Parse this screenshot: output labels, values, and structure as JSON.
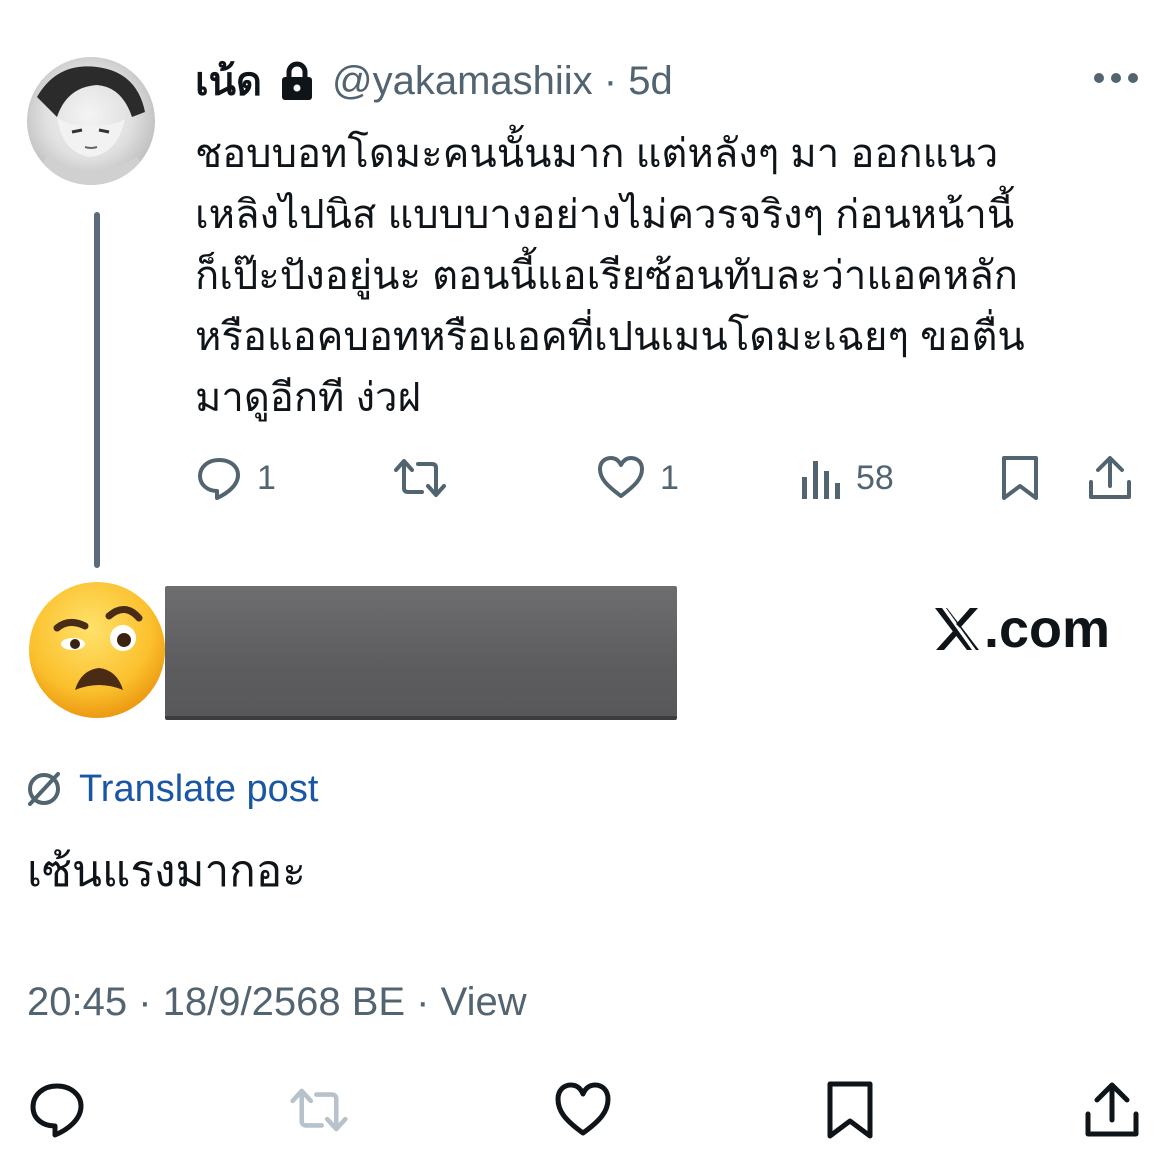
{
  "parent_tweet": {
    "display_name": "เน้ด",
    "handle_time": "@yakamashiix · 5d",
    "body_lines": [
      "ชอบบอทโดมะคนนั้นมาก แต่หลังๆ มา ออกแนว",
      "เหลิงไปนิส แบบบางอย่างไม่ควรจริงๆ ก่อนหน้านี้",
      "ก็เป๊ะปังอยู่นะ ตอนนี้แอเรียซ้อนทับละว่าแอคหลัก",
      "หรือแอคบอทหรือแอคที่เปนเมนโดมะเฉยๆ ขอตื่น",
      "มาดูอีกที ง่วฝ"
    ],
    "actions": {
      "replies": "1",
      "likes": "1",
      "views": "58"
    },
    "icons": [
      "lock-icon",
      "more-icon",
      "reply-icon",
      "repost-icon",
      "like-icon",
      "views-icon",
      "bookmark-icon",
      "share-icon"
    ]
  },
  "reply_tweet": {
    "watermark": ".com",
    "translate_label": "Translate post",
    "text": "เซ้นแรงมากอะ",
    "meta": "20:45 · 18/9/2568 BE · View"
  },
  "colors": {
    "text": "#0f1419",
    "secondary": "#536471",
    "link": "#1a56a6",
    "thread_line": "#5b6b79",
    "redaction": "#616164"
  }
}
